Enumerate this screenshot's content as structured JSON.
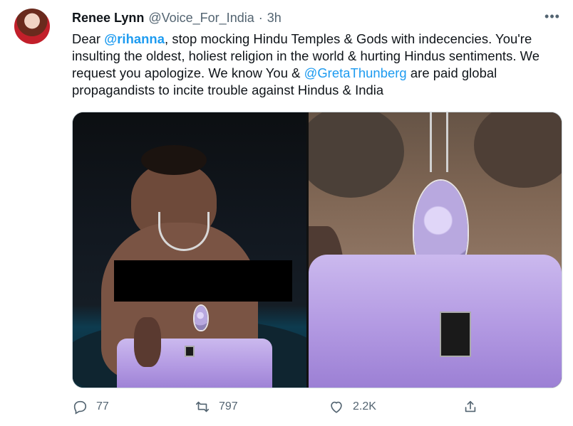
{
  "tweet": {
    "author_name": "Renee Lynn",
    "handle": "@Voice_For_India",
    "separator": "·",
    "time": "3h",
    "text_parts": {
      "p1": "Dear ",
      "mention1": "@rihanna",
      "p2": ", stop mocking Hindu Temples & Gods with indecencies. You're insulting the oldest, holiest religion in the world & hurting Hindus sentiments. We request you apologize. We know You & ",
      "mention2": "@GretaThunberg",
      "p3": " are paid global propagandists to incite trouble against Hindus & India"
    }
  },
  "actions": {
    "replies": "77",
    "retweets": "797",
    "likes": "2.2K"
  },
  "icons": {
    "more": "more-icon",
    "reply": "reply-icon",
    "retweet": "retweet-icon",
    "like": "heart-icon",
    "share": "share-icon"
  },
  "colors": {
    "text": "#0f1419",
    "secondary": "#536471",
    "mention": "#1d9bf0",
    "border": "#cfd9de"
  }
}
